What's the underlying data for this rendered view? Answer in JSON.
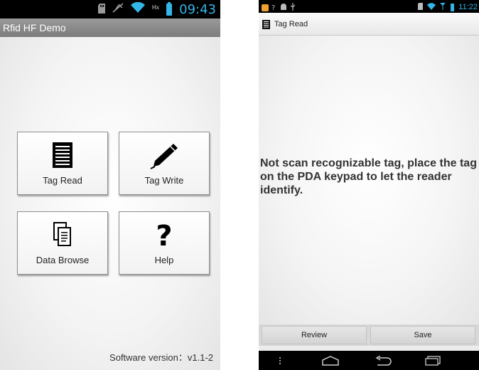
{
  "left_screen": {
    "status_bar": {
      "clock": "09:43",
      "network_label": "Hx"
    },
    "app_title": "Rfid HF Demo",
    "tiles": [
      {
        "id": "tag-read",
        "label": "Tag Read",
        "icon": "list-document-icon"
      },
      {
        "id": "tag-write",
        "label": "Tag Write",
        "icon": "pencil-icon"
      },
      {
        "id": "data-browse",
        "label": "Data Browse",
        "icon": "copy-documents-icon"
      },
      {
        "id": "help",
        "label": "Help",
        "icon": "question-icon",
        "glyph": "?"
      }
    ],
    "footer": {
      "version_text": "Software version：v1.1-2"
    }
  },
  "right_screen": {
    "status_bar": {
      "clock": "11:22"
    },
    "action_bar": {
      "title": "Tag Read",
      "icon": "list-document-icon"
    },
    "message": "Not scan recognizable tag, place the tag on the PDA keypad to let the reader identify.",
    "buttons": {
      "review": "Review",
      "save": "Save"
    },
    "nav_bar": {
      "icons": [
        "menu-icon",
        "home-icon",
        "back-icon",
        "recent-apps-icon"
      ]
    }
  },
  "colors": {
    "accent": "#33b5e5",
    "title_bar": "#8a8a8a",
    "status_bar": "#000000"
  }
}
